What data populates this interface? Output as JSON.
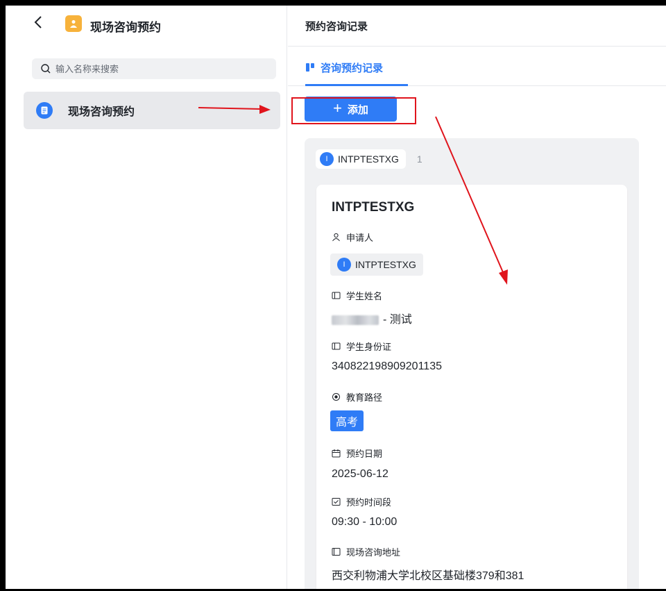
{
  "sidebar": {
    "app_title": "现场咨询预约",
    "search_placeholder": "输入名称来搜索",
    "items": [
      {
        "label": "现场咨询预约"
      }
    ]
  },
  "main": {
    "header_title": "预约咨询记录",
    "tabs": [
      {
        "label": "咨询预约记录"
      }
    ],
    "add_button_label": "添加",
    "group": {
      "avatar_letter": "I",
      "name": "INTPTESTXG",
      "count": "1"
    },
    "card": {
      "title": "INTPTESTXG",
      "applicant_label": "申请人",
      "applicant_avatar": "I",
      "applicant_name": "INTPTESTXG",
      "student_name_label": "学生姓名",
      "student_name_suffix": "- 测试",
      "student_id_label": "学生身份证",
      "student_id_value": "340822198909201135",
      "edu_path_label": "教育路径",
      "edu_path_value": "高考",
      "date_label": "预约日期",
      "date_value": "2025-06-12",
      "time_label": "预约时间段",
      "time_value": "09:30 - 10:00",
      "address_label": "现场咨询地址",
      "address_value": "西交利物浦大学北校区基础楼379和381"
    }
  },
  "colors": {
    "accent": "#2f7cf6",
    "app_icon": "#f7b23b",
    "annotation": "#e0141c"
  },
  "icons": [
    "chevron-left-icon",
    "app-person-icon",
    "search-icon",
    "document-icon",
    "kanban-icon",
    "user-icon",
    "textfield-icon",
    "radio-icon",
    "calendar-icon",
    "time-range-icon",
    "address-icon"
  ]
}
